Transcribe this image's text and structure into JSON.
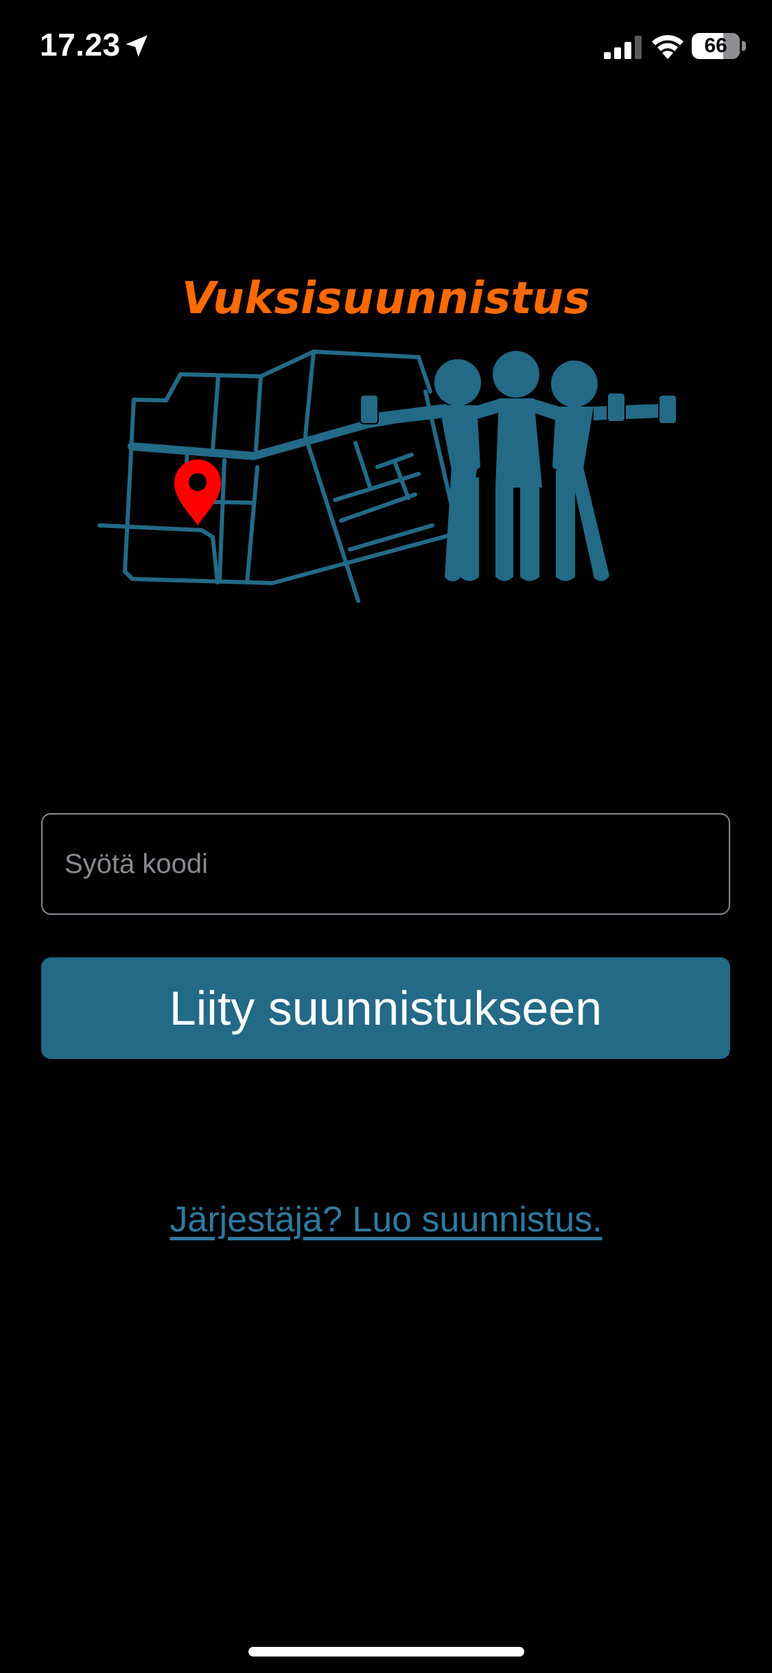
{
  "status_bar": {
    "time": "17.23",
    "battery_level": "66",
    "battery_fraction": 0.66,
    "icons": [
      "location-arrow-icon",
      "cellular-signal-icon",
      "wifi-icon",
      "battery-icon"
    ]
  },
  "logo": {
    "title": "Vuksisuunnistus",
    "title_color": "#ff6a00",
    "art_color": "#236a87",
    "pin_color": "#ff0000",
    "art_elements": [
      "street-map",
      "location-pin",
      "three-people-with-cans"
    ]
  },
  "form": {
    "code_placeholder": "Syötä koodi",
    "code_value": "",
    "join_label": "Liity suunnistukseen",
    "button_color": "#236a87"
  },
  "organizer_link": {
    "label": "Järjestäjä? Luo suunnistus.",
    "color": "#2e7aa0"
  }
}
